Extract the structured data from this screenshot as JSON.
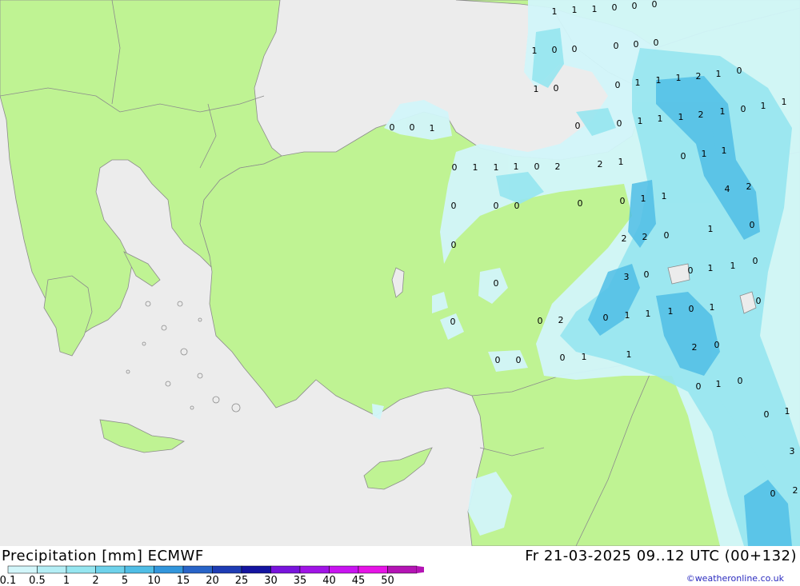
{
  "title": "Precipitation [mm] ECMWF",
  "valid_time": "Fr 21-03-2025 09..12 UTC (00+132)",
  "credit": "©weatheronline.co.uk",
  "legend": {
    "labels": [
      "0.1",
      "0.5",
      "1",
      "2",
      "5",
      "10",
      "15",
      "20",
      "25",
      "30",
      "35",
      "40",
      "45",
      "50"
    ],
    "colors": [
      "#d2f6fa",
      "#b4eef5",
      "#96e6f0",
      "#6ed2eb",
      "#50bee6",
      "#3296dc",
      "#2864c8",
      "#1e3cb4",
      "#1414a0",
      "#7814dc",
      "#a014e6",
      "#c814f0",
      "#e614e6",
      "#b414b4"
    ]
  },
  "colors": {
    "sea": "#ececec",
    "land": "#bff393",
    "precip_light": "#d2f6fa",
    "precip_medium": "#96e6f0",
    "precip_heavy": "#50bee6",
    "border": "#8c8c8c"
  },
  "point_values": [
    "1",
    "1",
    "1",
    "0",
    "0",
    "0",
    "1",
    "0",
    "0",
    "0",
    "0",
    "0",
    "1",
    "0",
    "0",
    "1",
    "1",
    "1",
    "2",
    "1",
    "0",
    "0",
    "0",
    "1",
    "0",
    "0",
    "1",
    "1",
    "1",
    "2",
    "1",
    "0",
    "1",
    "1",
    "0",
    "1",
    "1",
    "1",
    "0",
    "2",
    "2",
    "1",
    "0",
    "1",
    "1",
    "4",
    "2",
    "0",
    "0",
    "0",
    "0",
    "0",
    "1",
    "1",
    "1",
    "0",
    "2",
    "2",
    "0",
    "0",
    "0",
    "1",
    "1",
    "3",
    "0",
    "0",
    "0",
    "0",
    "0",
    "0",
    "2",
    "0",
    "1",
    "1",
    "1",
    "0",
    "1",
    "2",
    "0",
    "0",
    "0",
    "0",
    "1",
    "1",
    "0",
    "1",
    "0",
    "0",
    "1",
    "3",
    "0",
    "2"
  ]
}
